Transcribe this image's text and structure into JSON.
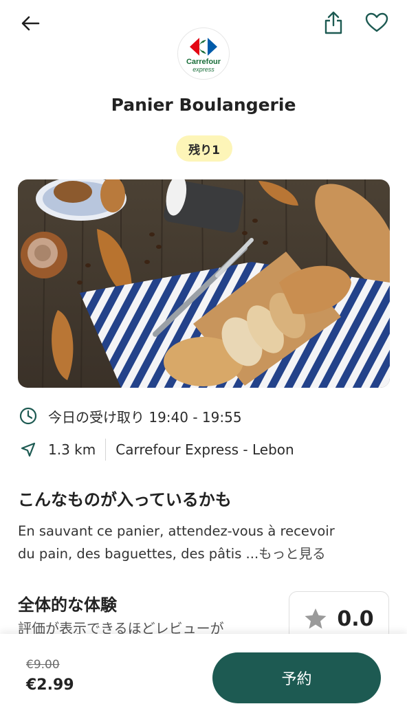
{
  "header": {
    "back_icon": "arrow-left-icon",
    "share_icon": "share-icon",
    "favorite_icon": "heart-icon"
  },
  "store": {
    "logo_name": "Carrefour",
    "logo_sub": "express",
    "brand_colors": {
      "green": "#1a6e3a",
      "red": "#e30613",
      "blue": "#005baa"
    }
  },
  "bag": {
    "title": "Panier Boulangerie",
    "remaining_badge": "残り1"
  },
  "pickup": {
    "icon": "clock-icon",
    "label": "今日の受け取り 19:40 - 19:55"
  },
  "location": {
    "icon": "navigation-arrow-icon",
    "distance": "1.3 km",
    "store_name": "Carrefour Express - Lebon"
  },
  "contents": {
    "heading": "こんなものが入っているかも",
    "description_line1": "En sauvant ce panier,  attendez-vous à recevoir",
    "description_line2": "du pain, des baguettes, des pâtis ...",
    "more_link": "もっと見る"
  },
  "experience": {
    "heading": "全体的な体験",
    "subtext": "評価が表示できるほどレビューが",
    "rating_icon": "star-icon",
    "rating_value": "0.0"
  },
  "checkout": {
    "original_price": "€9.00",
    "price": "€2.99",
    "reserve_label": "予約",
    "accent_color": "#1d5a52"
  }
}
